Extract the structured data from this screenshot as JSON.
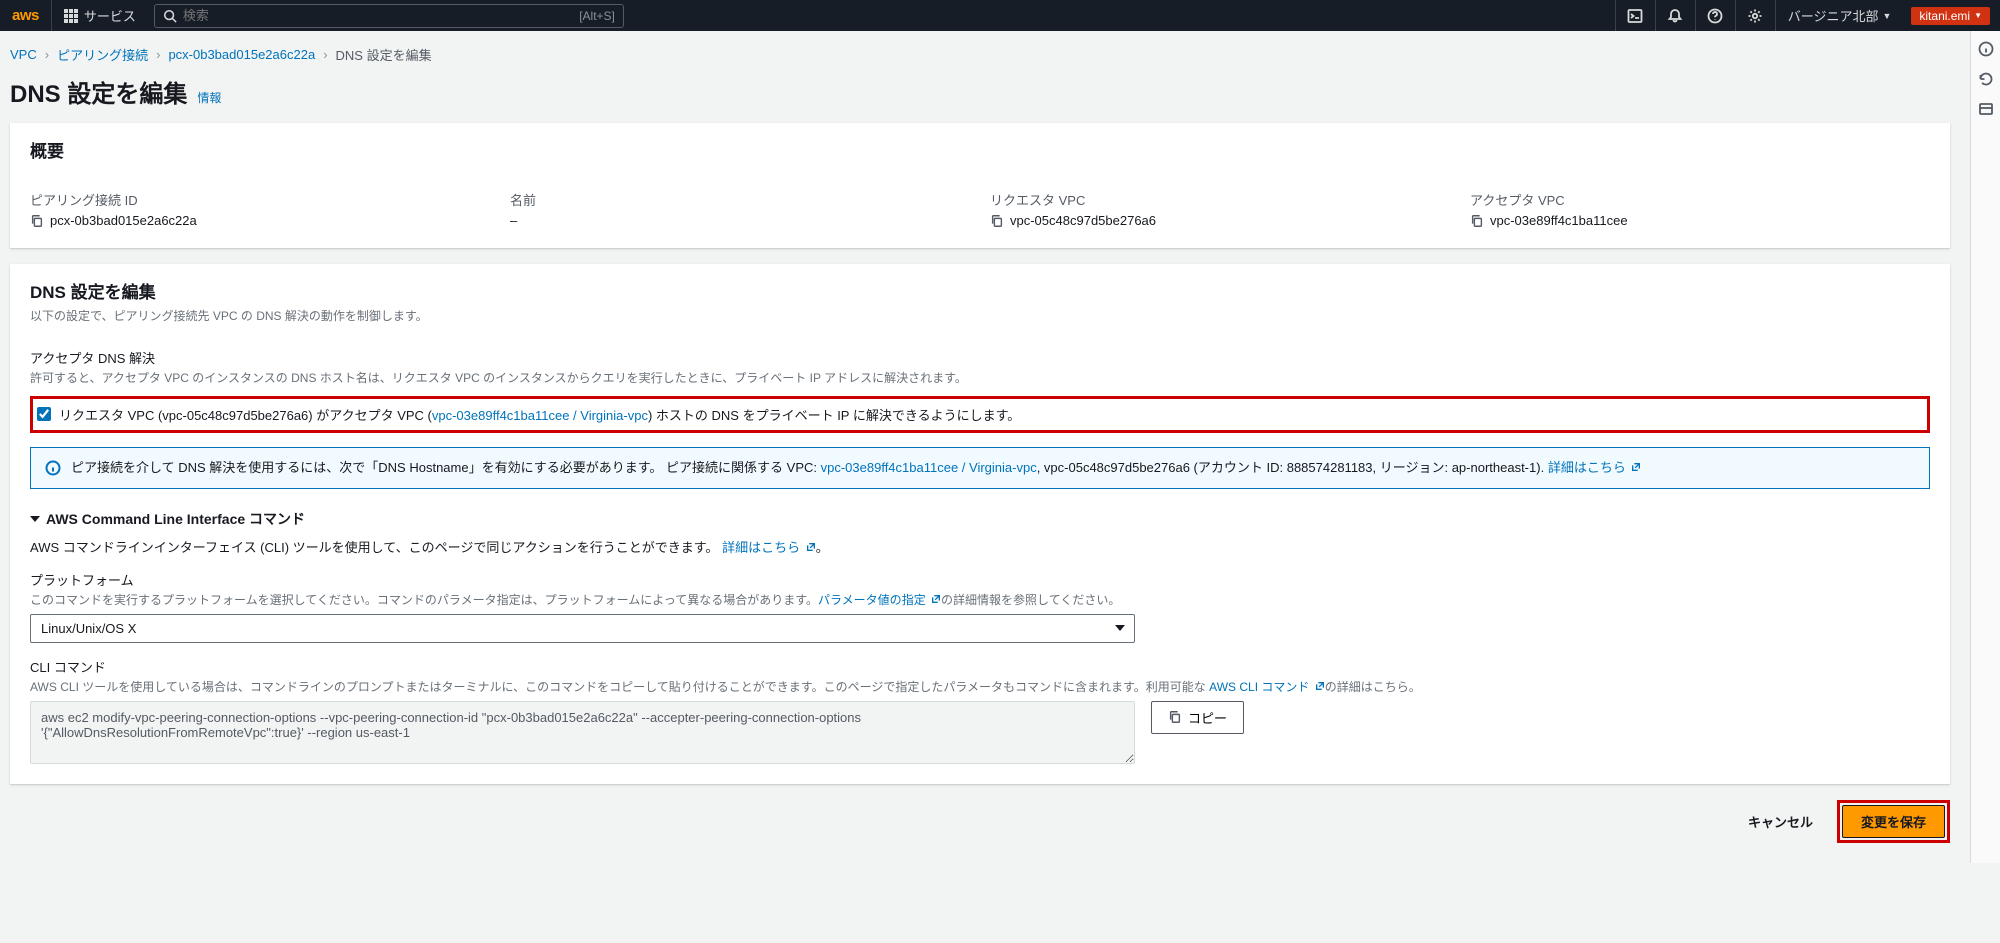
{
  "topnav": {
    "services_label": "サービス",
    "search_placeholder": "検索",
    "search_shortcut": "[Alt+S]",
    "region_label": "バージニア北部",
    "user_label": "kitani.emi"
  },
  "breadcrumbs": {
    "items": [
      "VPC",
      "ピアリング接続",
      "pcx-0b3bad015e2a6c22a"
    ],
    "current": "DNS 設定を編集"
  },
  "page": {
    "title": "DNS 設定を編集",
    "info_label": "情報"
  },
  "overview": {
    "header": "概要",
    "peering_id_label": "ピアリング接続 ID",
    "peering_id_value": "pcx-0b3bad015e2a6c22a",
    "name_label": "名前",
    "name_value": "–",
    "requester_label": "リクエスタ VPC",
    "requester_value": "vpc-05c48c97d5be276a6",
    "accepter_label": "アクセプタ VPC",
    "accepter_value": "vpc-03e89ff4c1ba11cee"
  },
  "dns_settings": {
    "header": "DNS 設定を編集",
    "desc": "以下の設定で、ピアリング接続先 VPC の DNS 解決の動作を制御します。",
    "section1_label": "アクセプタ DNS 解決",
    "section1_help": "許可すると、アクセプタ VPC のインスタンスの DNS ホスト名は、リクエスタ VPC のインスタンスからクエリを実行したときに、プライベート IP アドレスに解決されます。",
    "checkbox1_pre": "リクエスタ VPC (vpc-05c48c97d5be276a6) がアクセプタ VPC (",
    "checkbox1_link": "vpc-03e89ff4c1ba11cee / Virginia-vpc",
    "checkbox1_post": ") ホストの DNS をプライベート IP に解決できるようにします。",
    "info_pre": "ピア接続を介して DNS 解決を使用するには、次で「DNS Hostname」を有効にする必要があります。 ピア接続に関係する VPC: ",
    "info_link": "vpc-03e89ff4c1ba11cee / Virginia-vpc",
    "info_mid": ", vpc-05c48c97d5be276a6 (アカウント ID: 888574281183, リージョン: ap-northeast-1). ",
    "info_more": "詳細はこちら"
  },
  "cli": {
    "header": "AWS Command Line Interface コマンド",
    "desc_pre": "AWS コマンドラインインターフェイス (CLI) ツールを使用して、このページで同じアクションを行うことができます。",
    "desc_more": "詳細はこちら",
    "platform_label": "プラットフォーム",
    "platform_help_pre": "このコマンドを実行するプラットフォームを選択してください。コマンドのパラメータ指定は、プラットフォームによって異なる場合があります。",
    "platform_help_link": "パラメータ値の指定",
    "platform_help_post": "の詳細情報を参照してください。",
    "platform_value": "Linux/Unix/OS X",
    "cmd_label": "CLI コマンド",
    "cmd_help_pre": "AWS CLI ツールを使用している場合は、コマンドラインのプロンプトまたはターミナルに、このコマンドをコピーして貼り付けることができます。このページで指定したパラメータもコマンドに含まれます。利用可能な ",
    "cmd_help_link": "AWS CLI コマンド",
    "cmd_help_post": "の詳細はこちら。",
    "cmd_value": "aws ec2 modify-vpc-peering-connection-options --vpc-peering-connection-id \"pcx-0b3bad015e2a6c22a\" --accepter-peering-connection-options '{\"AllowDnsResolutionFromRemoteVpc\":true}' --region us-east-1",
    "copy_label": "コピー"
  },
  "footer": {
    "cancel": "キャンセル",
    "save": "変更を保存"
  }
}
